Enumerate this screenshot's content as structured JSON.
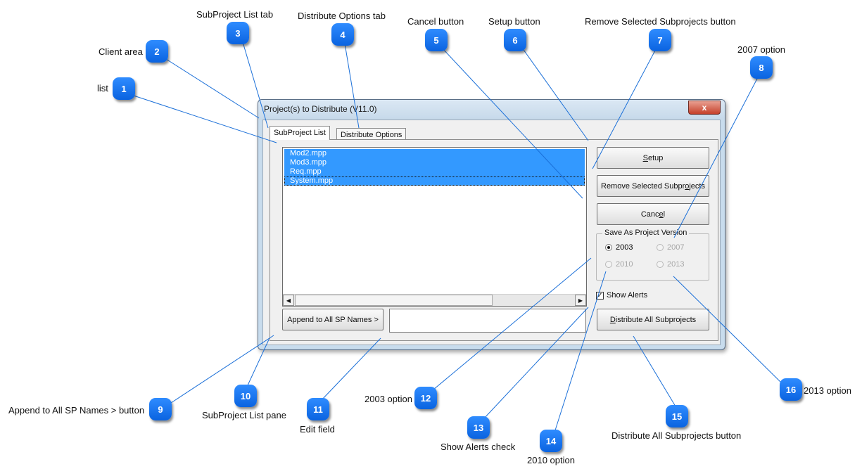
{
  "dialog": {
    "title": "Project(s) to Distribute (V11.0)",
    "close_icon": "close-icon",
    "close_glyph": "x"
  },
  "tabs": [
    {
      "label": "SubProject List",
      "active": true
    },
    {
      "label": "Distribute Options",
      "active": false
    }
  ],
  "list": {
    "items": [
      "Mod2.mpp",
      "Mod3.mpp",
      "Req.mpp",
      "System.mpp"
    ],
    "selection_color": "#3399ff"
  },
  "buttons": {
    "setup_pre": "",
    "setup_ul": "S",
    "setup_post": "etup",
    "remove_pre": "Remove Selected Subpr",
    "remove_ul": "o",
    "remove_post": "jects",
    "cancel_pre": "Canc",
    "cancel_ul": "e",
    "cancel_post": "l",
    "append": "Append to All SP Names >",
    "distribute_pre": "",
    "distribute_ul": "D",
    "distribute_post": "istribute All Subprojects"
  },
  "edit_field": {
    "value": ""
  },
  "save_as": {
    "legend": "Save As Project Version",
    "options": [
      {
        "label": "2003",
        "selected": true,
        "enabled": true
      },
      {
        "label": "2007",
        "selected": false,
        "enabled": false
      },
      {
        "label": "2010",
        "selected": false,
        "enabled": false
      },
      {
        "label": "2013",
        "selected": false,
        "enabled": false
      }
    ]
  },
  "show_alerts": {
    "label": "Show Alerts",
    "checked": true
  },
  "annotations": [
    {
      "num": "1",
      "label": "list"
    },
    {
      "num": "2",
      "label": "Client area"
    },
    {
      "num": "3",
      "label": "SubProject List  tab"
    },
    {
      "num": "4",
      "label": "Distribute Options tab"
    },
    {
      "num": "5",
      "label": "Cancel button"
    },
    {
      "num": "6",
      "label": "Setup button"
    },
    {
      "num": "7",
      "label": "Remove Selected Subprojects button"
    },
    {
      "num": "8",
      "label": "2007 option"
    },
    {
      "num": "9",
      "label": "Append to All SP Names > button"
    },
    {
      "num": "10",
      "label": "SubProject List  pane"
    },
    {
      "num": "11",
      "label": "Edit field"
    },
    {
      "num": "12",
      "label": "2003 option"
    },
    {
      "num": "13",
      "label": "Show Alerts check"
    },
    {
      "num": "14",
      "label": "2010 option"
    },
    {
      "num": "15",
      "label": "Distribute All Subprojects button"
    },
    {
      "num": "16",
      "label": "2013 option"
    }
  ],
  "colors": {
    "badge": "#1a75ff",
    "title_bar": "#c6d9ea",
    "close_button": "#c5402a"
  }
}
